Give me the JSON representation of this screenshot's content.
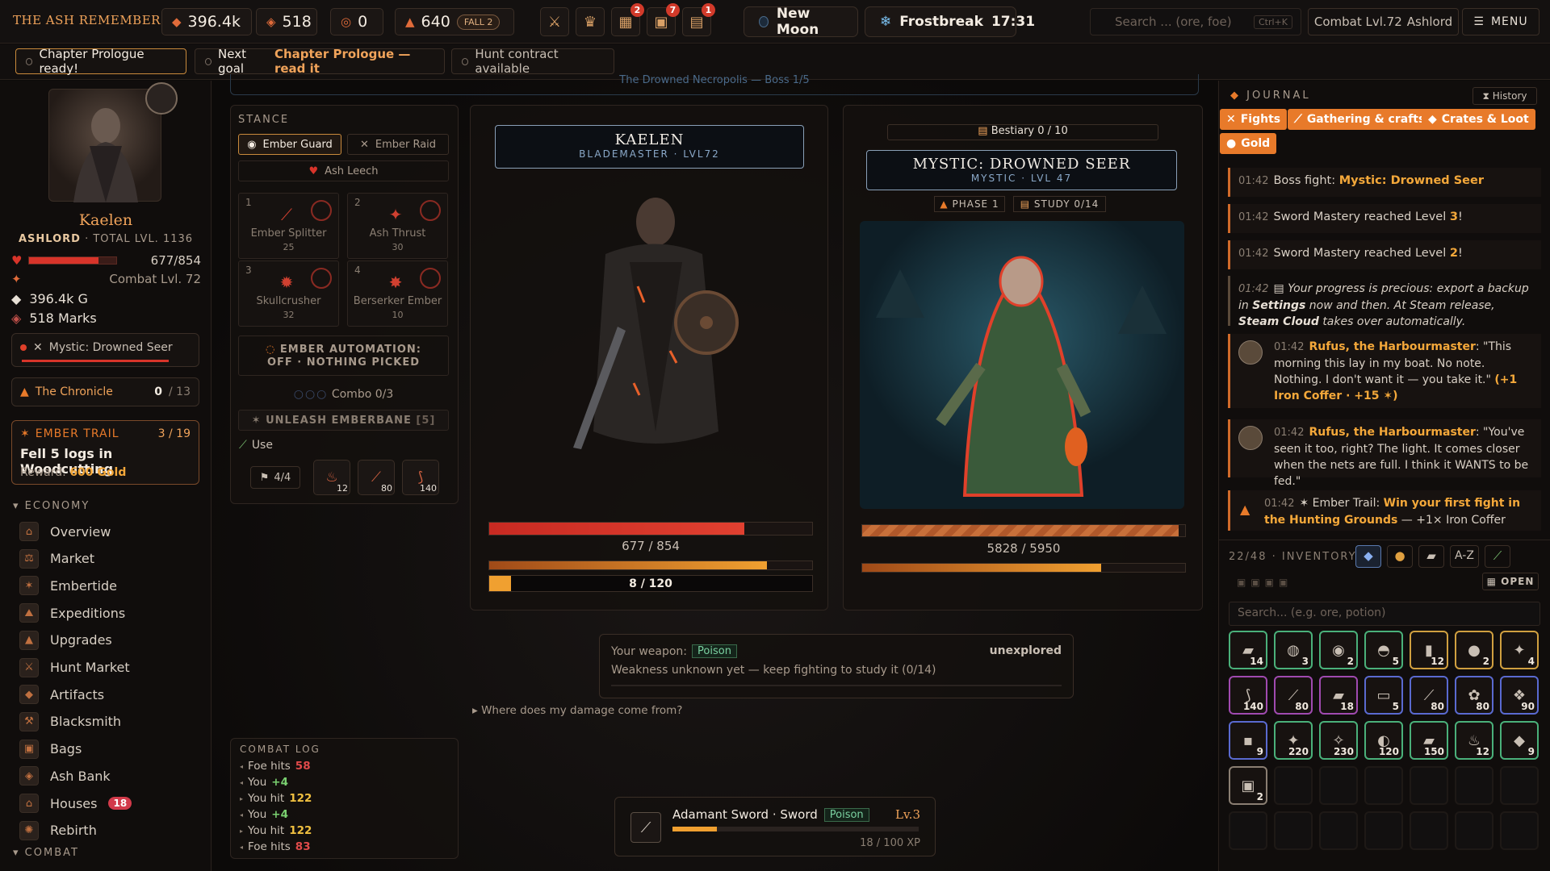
{
  "topbar": {
    "title": "THE ASH REMEMBERS",
    "gold": "396.4k",
    "marks": "518",
    "coins": "0",
    "embers": "640",
    "fall_pill": "FALL 2",
    "badges": {
      "crate": "2",
      "chest": "7",
      "book": "1"
    },
    "moon": "New Moon",
    "weather": "Frostbreak",
    "clock": "17:31",
    "search_placeholder": "Search ... (ore, foe)",
    "search_kbd": "Ctrl+K",
    "combat_level": "Combat Lvl.72",
    "region": "Ashlord",
    "menu": "MENU"
  },
  "subbar": {
    "chip1": "Chapter Prologue ready!",
    "chip2_prefix": "Next goal",
    "chip2_goal": "Chapter Prologue — read it",
    "chip3": "Hunt contract available"
  },
  "left": {
    "name": "Kaelen",
    "title": "ASHLORD",
    "total_level": "· TOTAL LVL. 1136",
    "hp": "677/854",
    "hp_frac": 0.79,
    "combat_level": "Combat Lvl. 72",
    "gold": "396.4k G",
    "marks": "518 Marks",
    "current_foe": "Mystic: Drowned Seer",
    "chronicle_label": "The Chronicle",
    "chronicle_count": "0",
    "chronicle_total": "/ 13",
    "trail_label": "EMBER TRAIL",
    "trail_progress": "3 / 19",
    "trail_task": "Fell 5 logs in Woodcutting",
    "trail_reward_label": "Reward:",
    "trail_reward": "600 Gold",
    "economy_header": "ECONOMY",
    "nav": [
      "Overview",
      "Market",
      "Embertide",
      "Expeditions",
      "Upgrades",
      "Hunt Market",
      "Artifacts",
      "Blacksmith",
      "Bags",
      "Ash Bank",
      "Houses",
      "Rebirth"
    ],
    "houses_badge": "18",
    "combat_header": "COMBAT"
  },
  "center": {
    "banner": "The Drowned Necropolis — Boss 1/5",
    "stance_label": "STANCE",
    "stance1": "Ember Guard",
    "stance2": "Ember Raid",
    "ash_leech": "Ash Leech",
    "skills": [
      {
        "n": "1",
        "name": "Ember Splitter",
        "count": "25"
      },
      {
        "n": "2",
        "name": "Ash Thrust",
        "count": "30"
      },
      {
        "n": "3",
        "name": "Skullcrusher",
        "count": "32"
      },
      {
        "n": "4",
        "name": "Berserker Ember",
        "count": "10"
      }
    ],
    "automation_1": "EMBER AUTOMATION:",
    "automation_2": "OFF · NOTHING PICKED",
    "combo": "Combo 0/3",
    "unleash": "UNLEASH EMBERBANE",
    "unleash_count": "[5]",
    "use_label": "Use",
    "potion_count": "4/4",
    "slots": [
      "12",
      "80",
      "140"
    ],
    "player_name": "KAELEN",
    "player_sub": "BLADEMASTER · LVL72",
    "player_hp": "677 / 854",
    "player_hp_frac": 0.79,
    "player_stamina_frac": 0.86,
    "player_xp": "8 / 120",
    "player_xp_frac": 0.067,
    "bestiary": "Bestiary 0 / 10",
    "foe_name": "MYSTIC: DROWNED SEER",
    "foe_sub": "MYSTIC · LVL 47",
    "phase": "PHASE 1",
    "study": "STUDY 0/14",
    "foe_hp": "5828 / 5950",
    "foe_hp_frac": 0.98,
    "foe_stamina_frac": 0.74,
    "weapon_label": "Your weapon:",
    "weapon_type": "Poison",
    "unexplored": "unexplored",
    "weakness_text": "Weakness unknown yet — keep fighting to study it (0/14)",
    "damage_q": "Where does my damage come from?",
    "log_header": "COMBAT LOG",
    "log": [
      {
        "who": "Foe hits",
        "val": "58",
        "kind": "foe"
      },
      {
        "who": "You",
        "val": "+4",
        "kind": "heal"
      },
      {
        "who": "You hit",
        "val": "122",
        "kind": "you"
      },
      {
        "who": "You",
        "val": "+4",
        "kind": "heal"
      },
      {
        "who": "You hit",
        "val": "122",
        "kind": "you"
      },
      {
        "who": "Foe hits",
        "val": "83",
        "kind": "foe"
      }
    ],
    "weapon_name": "Adamant Sword · Sword",
    "weapon_tag": "Poison",
    "weapon_level": "Lv.3",
    "weapon_xp": "18 / 100 XP",
    "weapon_xp_frac": 0.18
  },
  "right": {
    "journal_label": "JOURNAL",
    "history": "History",
    "filters": [
      "Fights",
      "Gathering & crafts",
      "Crates & Loot",
      "Gold"
    ],
    "entries": {
      "e1_time": "01:42",
      "e1_pre": "Boss fight:",
      "e1_b": "Mystic: Drowned Seer",
      "e2_time": "01:42",
      "e2_pre": "Sword Mastery reached Level",
      "e2_b": "3",
      "e3_time": "01:42",
      "e3_pre": "Sword Mastery reached Level",
      "e3_b": "2",
      "e4_time": "01:42",
      "e4_a": "Your progress is precious: export a backup in",
      "e4_b1": "Settings",
      "e4_c": "now and then. At Steam release,",
      "e4_b2": "Steam Cloud",
      "e4_d": "takes over automatically.",
      "e5_time": "01:42",
      "e5_name": "Rufus, the Harbourmaster",
      "e5_text": ": \"This morning this lay in my boat. No note. Nothing. I don't want it — you take it.\"",
      "e5_reward": "(+1 Iron Coffer · +15",
      "e6_time": "01:42",
      "e6_name": "Rufus, the Harbourmaster",
      "e6_text": ": \"You've seen it too, right? The light. It comes closer when the nets are full. I think it WANTS to be fed.\"",
      "e7_time": "01:42",
      "e7_pre": "Ember Trail:",
      "e7_b": "Win your first fight in the Hunting Grounds",
      "e7_post": "— +1× Iron Coffer"
    },
    "inv_label": "22/48 · INVENTORY",
    "sort_label": "A-Z",
    "open_label": "OPEN",
    "inv_search": "Search... (e.g. ore, potion)",
    "items": [
      "14",
      "3",
      "2",
      "5",
      "12",
      "2",
      "4",
      "140",
      "80",
      "18",
      "5",
      "80",
      "80",
      "90",
      "9",
      "220",
      "230",
      "120",
      "150",
      "12",
      "9",
      "2"
    ]
  },
  "colors": {
    "accent": "#f0a35a",
    "ember": "#e87a2a",
    "hp": "#d8342a",
    "frame": "#8aa0b8"
  }
}
